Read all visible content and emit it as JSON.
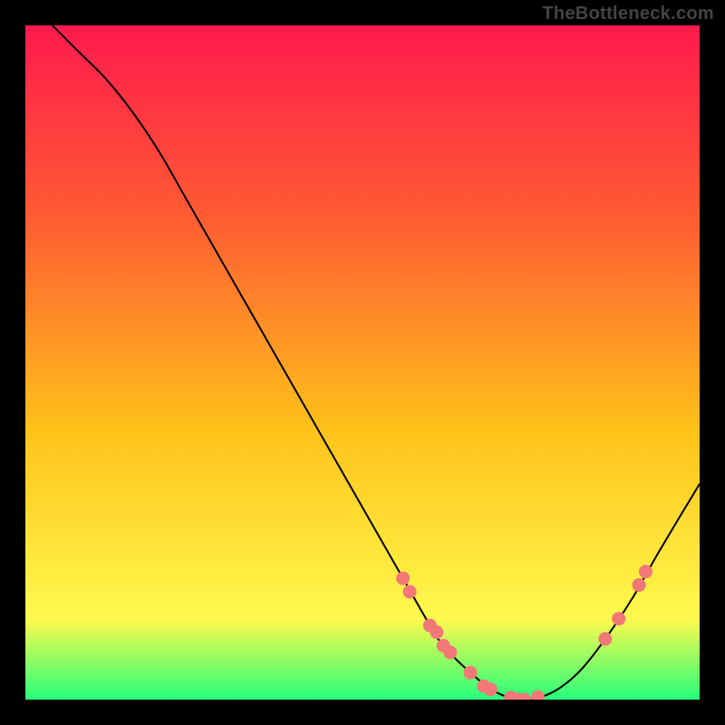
{
  "watermark": "TheBottleneck.com",
  "chart_data": {
    "type": "line",
    "title": "",
    "xlabel": "",
    "ylabel": "",
    "xlim": [
      0,
      100
    ],
    "ylim": [
      0,
      100
    ],
    "grid": false,
    "legend": false,
    "series": [
      {
        "name": "bottleneck-curve",
        "x": [
          4,
          8,
          12,
          16,
          20,
          24,
          28,
          32,
          36,
          40,
          44,
          48,
          52,
          56,
          60,
          62,
          66,
          70,
          74,
          78,
          82,
          86,
          90,
          94,
          100
        ],
        "values": [
          100,
          96,
          92,
          87,
          81,
          74,
          67,
          60,
          53,
          46,
          39,
          32,
          25,
          18,
          11,
          8,
          4,
          1,
          0,
          1,
          4,
          9,
          15,
          22,
          32
        ]
      }
    ],
    "highlight_points": {
      "name": "marker-dots",
      "x": [
        56,
        57,
        60,
        61,
        62,
        63,
        66,
        68,
        69,
        72,
        73,
        74,
        76,
        86,
        88,
        91,
        92
      ],
      "values": [
        18,
        16,
        11,
        10,
        8,
        7,
        4,
        2,
        1.5,
        0.3,
        0,
        0,
        0.4,
        9,
        12,
        17,
        19
      ]
    },
    "background_gradient": {
      "top": "#ff1a4d",
      "mid_top": "#ff5a33",
      "mid": "#ffc21a",
      "mid_bottom": "#fff94d",
      "bottom": "#26ff7a"
    }
  }
}
